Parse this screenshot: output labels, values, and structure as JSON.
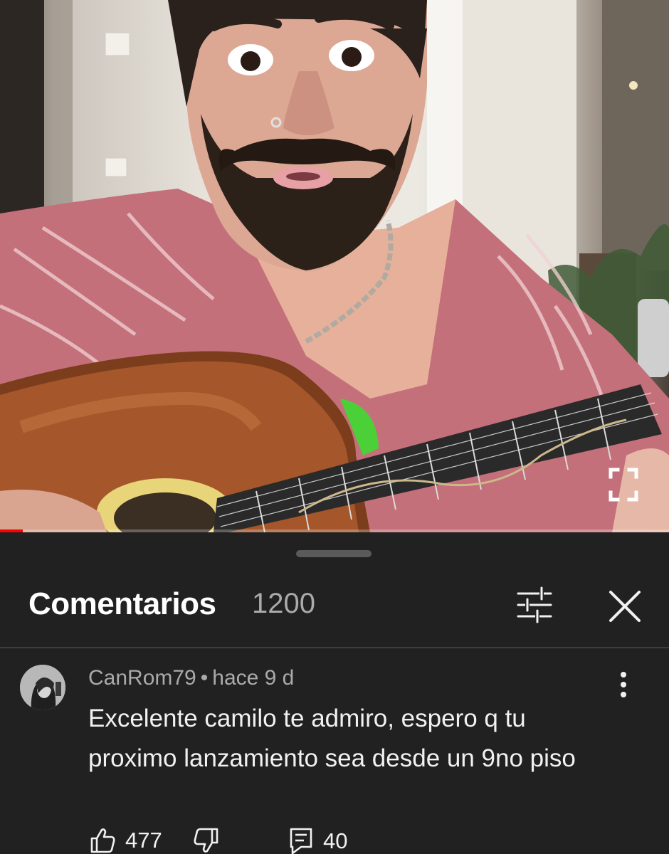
{
  "video": {
    "progress_fraction": 0.034,
    "icons": {
      "fullscreen": "fullscreen-icon"
    }
  },
  "comments_panel": {
    "title": "Comentarios",
    "count": "1200",
    "icons": {
      "filter": "sliders-icon",
      "close": "close-icon"
    }
  },
  "comment": {
    "author": "CanRom79",
    "separator": "•",
    "time": "hace 9 d",
    "text_line1": "Excelente camilo te admiro, espero q tu",
    "text_line2": "proximo lanzamiento sea desde un 9no piso",
    "likes": "477",
    "replies": "40",
    "icons": {
      "like": "thumbs-up-icon",
      "dislike": "thumbs-down-icon",
      "reply": "reply-icon",
      "menu": "more-vert-icon"
    }
  },
  "colors": {
    "background": "#212121",
    "progress": "#ff0000",
    "text": "#f1f1f1",
    "secondary_text": "#aaaaaa"
  }
}
